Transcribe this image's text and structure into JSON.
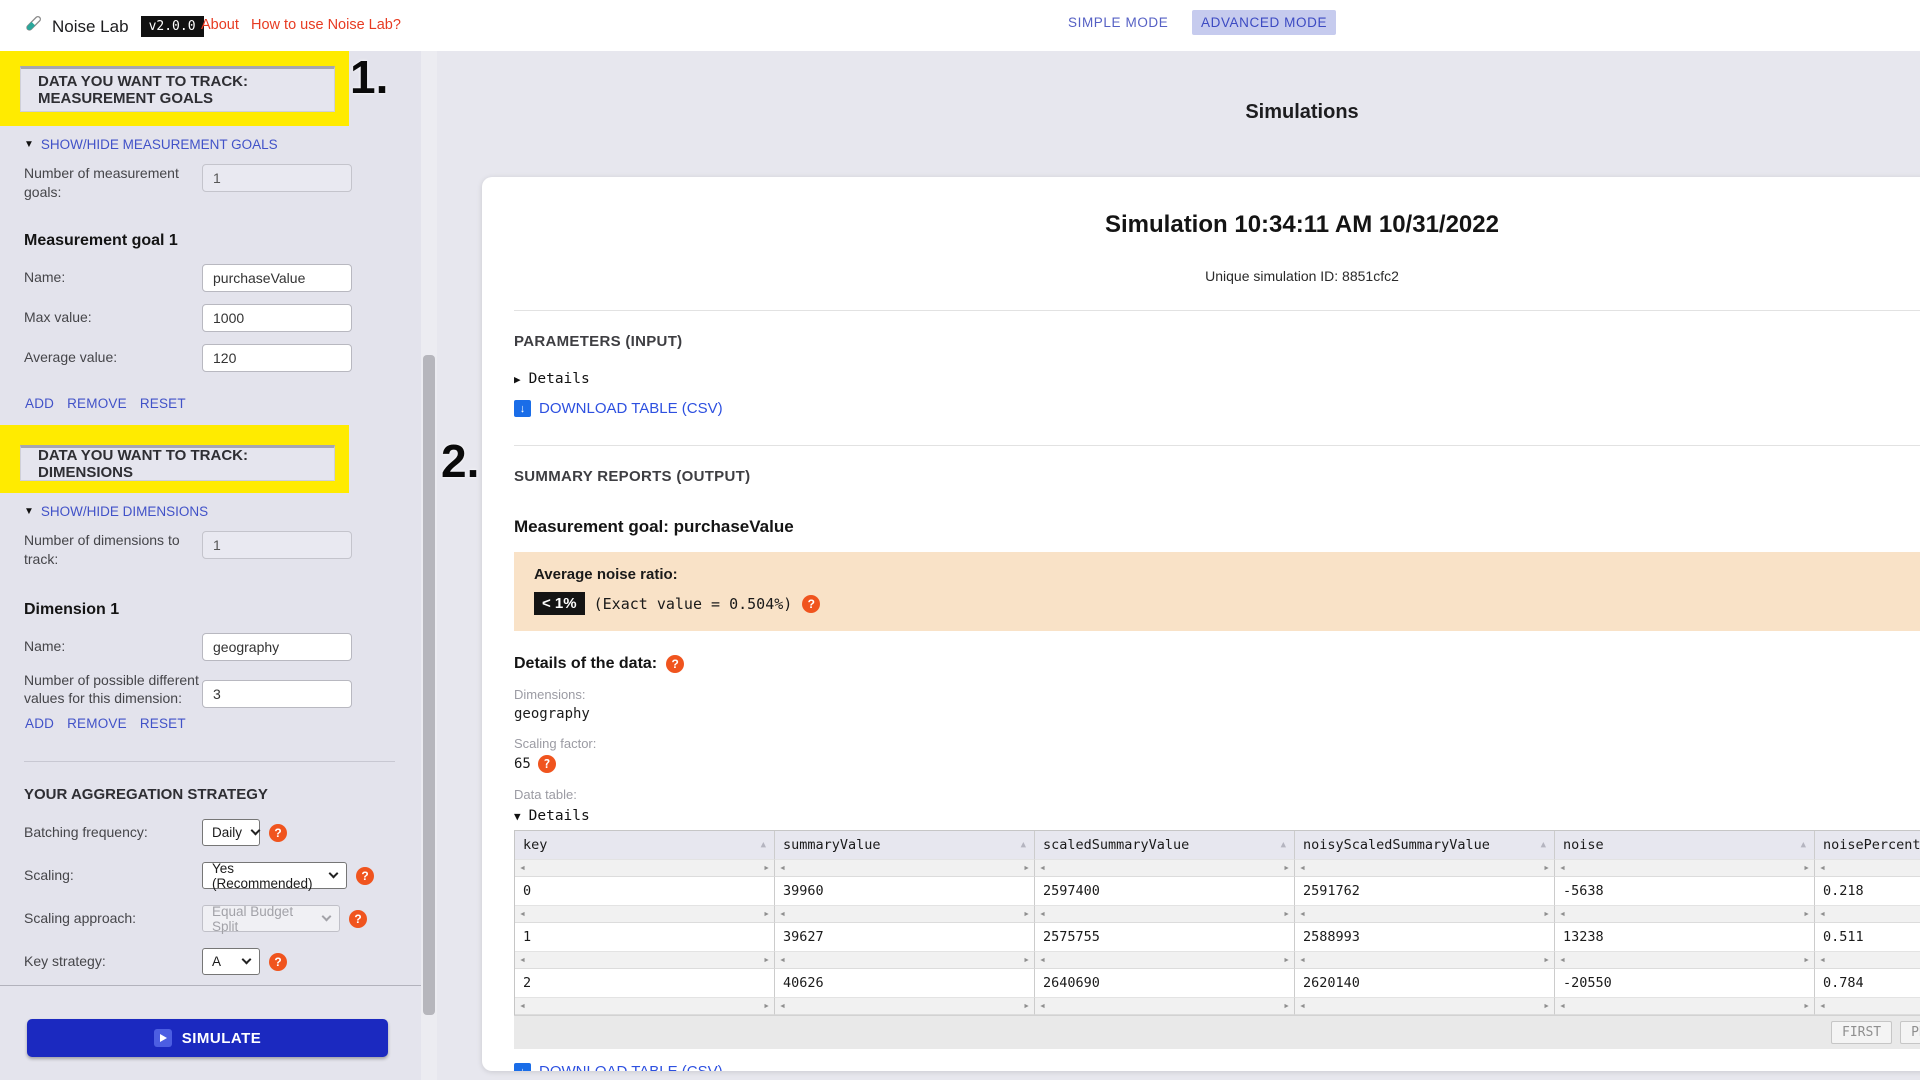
{
  "colors": {
    "highlight_yellow": "#ffeb00",
    "sidebar_link_blue": "#4152c8",
    "download_link_blue": "#2d50e0",
    "mode_indigo": "#5560c4",
    "nav_red": "#e73b22",
    "help_orange": "#f0541e",
    "noise_box_peach": "#f9e2c7",
    "simulate_blue": "#1b29c0",
    "badge_black": "#141414"
  },
  "topbar": {
    "app_name": "Noise Lab",
    "version": "v2.0.0",
    "about": "About",
    "howto": "How to use Noise Lab?",
    "simple_mode": "SIMPLE MODE",
    "advanced_mode": "ADVANCED MODE"
  },
  "annotations": {
    "step1": "1.",
    "step2": "2."
  },
  "measurement_goals": {
    "title": "DATA YOU WANT TO TRACK: MEASUREMENT GOALS",
    "toggle": "SHOW/HIDE MEASUREMENT GOALS",
    "count_label": "Number of measurement goals:",
    "count_value": "1",
    "goal_heading": "Measurement goal 1",
    "name_label": "Name:",
    "name_value": "purchaseValue",
    "max_label": "Max value:",
    "max_value": "1000",
    "avg_label": "Average value:",
    "avg_value": "120",
    "actions": [
      "ADD",
      "REMOVE",
      "RESET"
    ]
  },
  "dimensions": {
    "title": "DATA YOU WANT TO TRACK: DIMENSIONS",
    "toggle": "SHOW/HIDE DIMENSIONS",
    "count_label": "Number of dimensions to track:",
    "count_value": "1",
    "dim_heading": "Dimension 1",
    "name_label": "Name:",
    "name_value": "geography",
    "values_label": "Number of possible different values for this dimension:",
    "values_value": "3",
    "actions": [
      "ADD",
      "REMOVE",
      "RESET"
    ]
  },
  "aggregation": {
    "title": "YOUR AGGREGATION STRATEGY",
    "rows": [
      {
        "label": "Batching frequency:",
        "value": "Daily",
        "disabled": false
      },
      {
        "label": "Scaling:",
        "value": "Yes (Recommended)",
        "disabled": false
      },
      {
        "label": "Scaling approach:",
        "value": "Equal Budget Split",
        "disabled": true
      },
      {
        "label": "Key strategy:",
        "value": "A",
        "disabled": false
      }
    ]
  },
  "simulate_label": "SIMULATE",
  "main": {
    "page_title": "Simulations",
    "sim_heading": "Simulation 10:34:11 AM 10/31/2022",
    "sim_id": "Unique simulation ID: 8851cfc2",
    "parameters_title": "PARAMETERS (INPUT)",
    "details_label": "Details",
    "download_label": "DOWNLOAD TABLE (CSV)",
    "summary_title": "SUMMARY REPORTS (OUTPUT)",
    "goal_heading": "Measurement goal: purchaseValue",
    "noise_label": "Average noise ratio:",
    "noise_badge": "< 1%",
    "noise_exact": "(Exact value = 0.504%)",
    "data_details_heading": "Details of the data:",
    "dimensions_label": "Dimensions:",
    "dimensions_value": "geography",
    "scaling_label": "Scaling factor:",
    "scaling_value": "65",
    "datatable_label": "Data table:",
    "table_toggle": "Details",
    "table": {
      "columns": [
        "key",
        "summaryValue",
        "scaledSummaryValue",
        "noisyScaledSummaryValue",
        "noise",
        "noisePercentage"
      ],
      "rows": [
        [
          "0",
          "39960",
          "2597400",
          "2591762",
          "-5638",
          "0.218"
        ],
        [
          "1",
          "39627",
          "2575755",
          "2588993",
          "13238",
          "0.511"
        ],
        [
          "2",
          "40626",
          "2640690",
          "2620140",
          "-20550",
          "0.784"
        ]
      ],
      "pagination": [
        "FIRST",
        "PREV"
      ]
    },
    "download_label2": "DOWNLOAD TABLE (CSV)"
  }
}
